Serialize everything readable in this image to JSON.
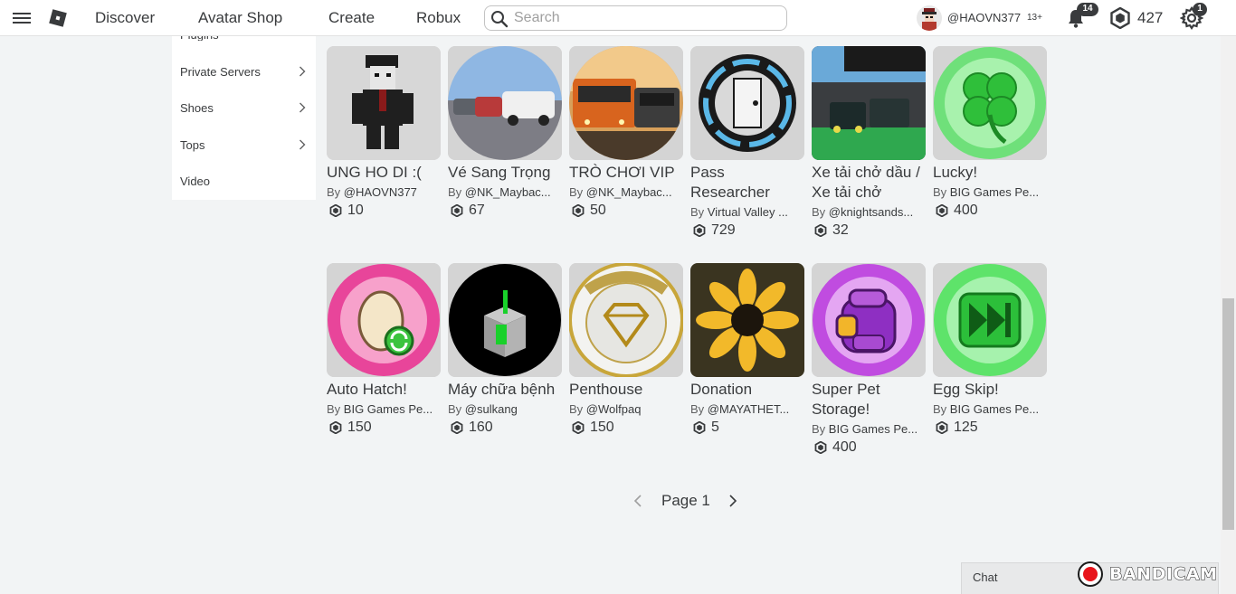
{
  "header": {
    "nav": [
      "Discover",
      "Avatar Shop",
      "Create",
      "Robux"
    ],
    "search_placeholder": "Search",
    "username": "@HAOVN377",
    "age_label": "13+",
    "notifications_count": "14",
    "robux_balance": "427",
    "settings_badge": "1"
  },
  "sidebar": {
    "clipped_item": "Plugins",
    "items": [
      {
        "label": "Private Servers",
        "has_chevron": true
      },
      {
        "label": "Shoes",
        "has_chevron": true
      },
      {
        "label": "Tops",
        "has_chevron": true
      },
      {
        "label": "Video",
        "has_chevron": false
      }
    ]
  },
  "items": [
    {
      "name": "UNG HO DI :(",
      "by": "By",
      "creator": "@HAOVN377",
      "price": "10",
      "thumb": "avatar-figure"
    },
    {
      "name": "Vé Sang Trọng",
      "by": "By",
      "creator": "@NK_Maybac...",
      "price": "67",
      "thumb": "cars-lot"
    },
    {
      "name": "TRÒ CHƠI VIP",
      "by": "By",
      "creator": "@NK_Maybac...",
      "price": "50",
      "thumb": "buses"
    },
    {
      "name": "Pass Researcher",
      "by": "By",
      "creator": "Virtual Valley ...",
      "price": "729",
      "thumb": "vault-door"
    },
    {
      "name": "Xe tải chở dầu / Xe tải chở",
      "by": "By",
      "creator": "@knightsands...",
      "price": "32",
      "thumb": "trucks"
    },
    {
      "name": "Lucky!",
      "by": "By",
      "creator": "BIG Games Pe...",
      "price": "400",
      "thumb": "clover"
    },
    {
      "name": "Auto Hatch!",
      "by": "By",
      "creator": "BIG Games Pe...",
      "price": "150",
      "thumb": "egg"
    },
    {
      "name": "Máy chữa bệnh",
      "by": "By",
      "creator": "@sulkang",
      "price": "160",
      "thumb": "machine"
    },
    {
      "name": "Penthouse",
      "by": "By",
      "creator": "@Wolfpaq",
      "price": "150",
      "thumb": "penthouse"
    },
    {
      "name": "Donation",
      "by": "By",
      "creator": "@MAYATHET...",
      "price": "5",
      "thumb": "sunflower"
    },
    {
      "name": "Super Pet Storage!",
      "by": "By",
      "creator": "BIG Games Pe...",
      "price": "400",
      "thumb": "backpack"
    },
    {
      "name": "Egg Skip!",
      "by": "By",
      "creator": "BIG Games Pe...",
      "price": "125",
      "thumb": "skip"
    }
  ],
  "pager": {
    "label": "Page 1"
  },
  "chat": {
    "label": "Chat"
  },
  "watermark": "BANDICAM",
  "colors": {
    "accent_green": "#2ecc40",
    "text": "#393b3d",
    "background": "#f2f4f5"
  }
}
